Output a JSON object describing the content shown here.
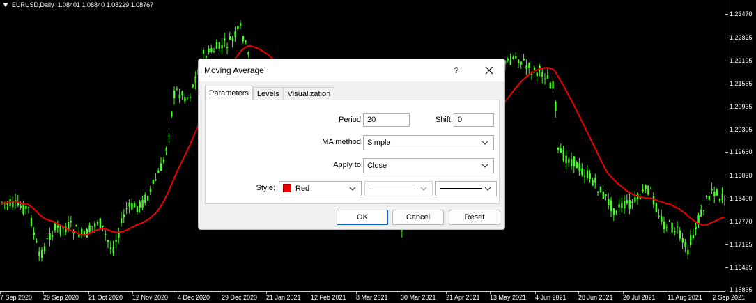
{
  "chart": {
    "symbol_line": "EURUSD,Daily  1.08401 1.08840 1.08229 1.08767",
    "price_ticks": [
      "1.23470",
      "1.22825",
      "1.22195",
      "1.21565",
      "1.20935",
      "1.20305",
      "1.19660",
      "1.19030",
      "1.18400",
      "1.17770",
      "1.17125",
      "1.16495",
      "1.15865"
    ],
    "time_ticks": [
      "7 Sep 2020",
      "29 Sep 2020",
      "21 Oct 2020",
      "12 Nov 2020",
      "4 Dec 2020",
      "29 Dec 2020",
      "21 Jan 2021",
      "12 Feb 2021",
      "8 Mar 2021",
      "30 Mar 2021",
      "21 Apr 2021",
      "13 May 2021",
      "4 Jun 2021",
      "28 Jun 2021",
      "20 Jul 2021",
      "11 Aug 2021",
      "2 Sep 2021"
    ],
    "candle_color": "#44ff22",
    "ma_color": "#ee0000",
    "axis_color": "#cfcfcf"
  },
  "dialog": {
    "title": "Moving Average",
    "help_label": "?",
    "tabs": [
      {
        "label": "Parameters",
        "active": true
      },
      {
        "label": "Levels",
        "active": false
      },
      {
        "label": "Visualization",
        "active": false
      }
    ],
    "period": {
      "label": "Period:",
      "value": "20"
    },
    "shift": {
      "label": "Shift:",
      "value": "0"
    },
    "ma_method": {
      "label": "MA method:",
      "value": "Simple"
    },
    "apply_to": {
      "label": "Apply to:",
      "value": "Close"
    },
    "style": {
      "label": "Style:",
      "color_name": "Red",
      "color_hex": "#ee0000"
    },
    "buttons": {
      "ok": "OK",
      "cancel": "Cancel",
      "reset": "Reset"
    }
  }
}
